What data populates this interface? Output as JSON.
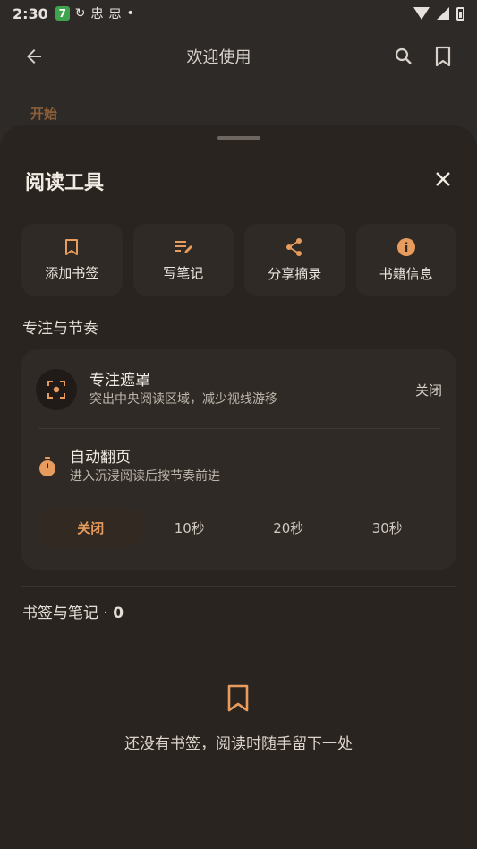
{
  "status_bar": {
    "time": "2:30",
    "badge": "7",
    "glyphs": [
      "↻",
      "忠",
      "忠",
      "•"
    ]
  },
  "app_bar": {
    "title": "欢迎使用"
  },
  "behind": {
    "section_label": "开始"
  },
  "sheet": {
    "title": "阅读工具",
    "tools": [
      {
        "label": "添加书签",
        "icon": "bookmark-icon"
      },
      {
        "label": "写笔记",
        "icon": "edit-note-icon"
      },
      {
        "label": "分享摘录",
        "icon": "share-icon"
      },
      {
        "label": "书籍信息",
        "icon": "info-icon"
      }
    ],
    "focus_section": "专注与节奏",
    "focus_mask": {
      "title": "专注遮罩",
      "subtitle": "突出中央阅读区域，减少视线游移",
      "value": "关闭"
    },
    "auto_page": {
      "title": "自动翻页",
      "subtitle": "进入沉浸阅读后按节奏前进",
      "options": [
        "关闭",
        "10秒",
        "20秒",
        "30秒"
      ],
      "selected": "关闭"
    },
    "bookmarks": {
      "title": "书签与笔记 · ",
      "count": "0",
      "empty_text": "还没有书签，阅读时随手留下一处"
    }
  },
  "colors": {
    "accent": "#e79c5d",
    "sheet_bg": "#2a2420",
    "card_bg": "#2f2a25"
  }
}
